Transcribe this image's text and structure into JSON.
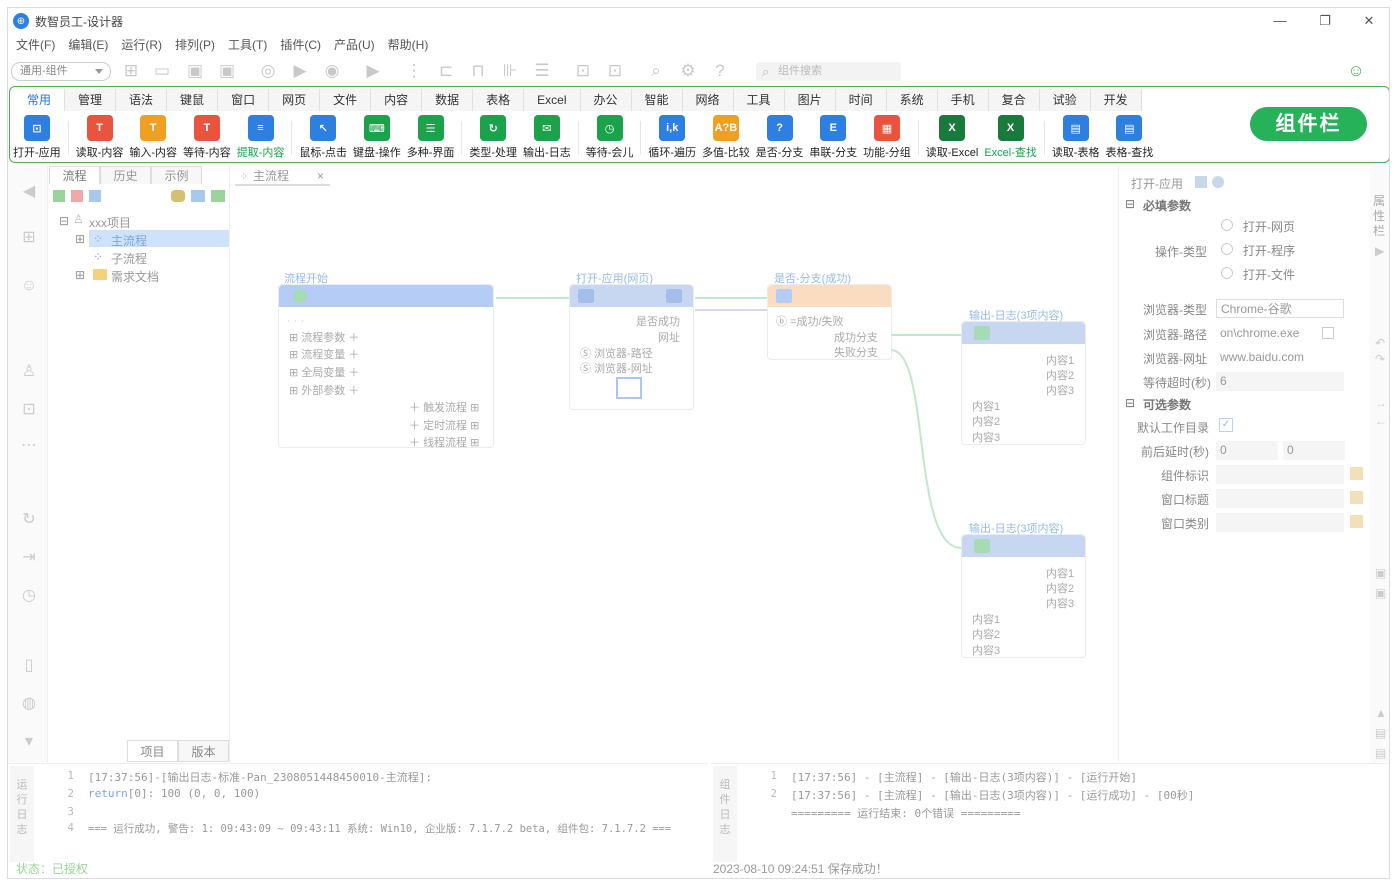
{
  "window": {
    "title": "数智员工-设计器",
    "minimize": "—",
    "maximize": "❐",
    "close": "✕"
  },
  "menu": [
    "文件(F)",
    "编辑(E)",
    "运行(R)",
    "排列(P)",
    "工具(T)",
    "插件(C)",
    "产品(U)",
    "帮助(H)"
  ],
  "toolbar": {
    "combo": "通用-组件",
    "search_placeholder": "组件搜索"
  },
  "component_tabs": [
    "常用",
    "管理",
    "语法",
    "键鼠",
    "窗口",
    "网页",
    "文件",
    "内容",
    "数据",
    "表格",
    "Excel",
    "办公",
    "智能",
    "网络",
    "工具",
    "图片",
    "时间",
    "系统",
    "手机",
    "复合",
    "试验",
    "开发"
  ],
  "components": [
    {
      "label": "打开-应用",
      "icon": "open-app-icon",
      "color": "#2d7fe0",
      "glyph": "⊡"
    },
    {
      "label": "读取-内容",
      "icon": "read-content-icon",
      "color": "#e8543d",
      "glyph": "T"
    },
    {
      "label": "输入-内容",
      "icon": "input-content-icon",
      "color": "#f0a020",
      "glyph": "T"
    },
    {
      "label": "等待-内容",
      "icon": "wait-content-icon",
      "color": "#e8543d",
      "glyph": "T"
    },
    {
      "label": "提取-内容",
      "icon": "extract-content-icon",
      "color": "#2d7fe0",
      "glyph": "≡",
      "green": true
    },
    {
      "label": "鼠标-点击",
      "icon": "mouse-click-icon",
      "color": "#2d7fe0",
      "glyph": "↖"
    },
    {
      "label": "键盘-操作",
      "icon": "keyboard-icon",
      "color": "#1aa34a",
      "glyph": "⌨"
    },
    {
      "label": "多种-界面",
      "icon": "multi-ui-icon",
      "color": "#1aa34a",
      "glyph": "☰"
    },
    {
      "label": "类型-处理",
      "icon": "type-process-icon",
      "color": "#1aa34a",
      "glyph": "↻"
    },
    {
      "label": "输出-日志",
      "icon": "output-log-icon",
      "color": "#1aa34a",
      "glyph": "✉"
    },
    {
      "label": "等待-会儿",
      "icon": "wait-icon",
      "color": "#1aa34a",
      "glyph": "◷"
    },
    {
      "label": "循环-遍历",
      "icon": "loop-icon",
      "color": "#2d7fe0",
      "glyph": "i,k"
    },
    {
      "label": "多值-比较",
      "icon": "compare-icon",
      "color": "#f0a020",
      "glyph": "A?B"
    },
    {
      "label": "是否-分支",
      "icon": "if-branch-icon",
      "color": "#2d7fe0",
      "glyph": "?"
    },
    {
      "label": "串联-分支",
      "icon": "serial-branch-icon",
      "color": "#2d7fe0",
      "glyph": "E"
    },
    {
      "label": "功能-分组",
      "icon": "function-group-icon",
      "color": "#e8543d",
      "glyph": "▦"
    },
    {
      "label": "读取-Excel",
      "icon": "read-excel-icon",
      "color": "#1a7a3c",
      "glyph": "X"
    },
    {
      "label": "Excel-查找",
      "icon": "excel-find-icon",
      "color": "#1a7a3c",
      "glyph": "X",
      "green": true
    },
    {
      "label": "读取-表格",
      "icon": "read-table-icon",
      "color": "#2d7fe0",
      "glyph": "▤"
    },
    {
      "label": "表格-查找",
      "icon": "table-find-icon",
      "color": "#2d7fe0",
      "glyph": "▤"
    }
  ],
  "badge": "组件栏",
  "left_panel": {
    "tabs": [
      "流程",
      "历史",
      "示例"
    ],
    "tree": {
      "root": "xxx项目",
      "children": [
        "主流程",
        "子流程",
        "需求文档"
      ]
    },
    "bottom_tabs": [
      "项目",
      "版本"
    ]
  },
  "canvas": {
    "tab": "主流程",
    "close": "×",
    "nodes": {
      "start": {
        "title": "流程开始",
        "rows": [
          "流程参数",
          "流程变量",
          "全局变量",
          "外部参数"
        ],
        "right_rows": [
          "触发流程",
          "定时流程",
          "线程流程"
        ],
        "dots": "· · ·"
      },
      "open": {
        "title": "打开-应用(网页)",
        "out": [
          "是否成功",
          "网址"
        ],
        "in": [
          "浏览器-路径",
          "浏览器-网址"
        ]
      },
      "branch": {
        "title": "是否-分支(成功)",
        "cond": "=成功/失败",
        "out": [
          "成功分支",
          "失败分支"
        ]
      },
      "log1": {
        "title": "输出-日志(3项内容)",
        "out": [
          "内容1",
          "内容2",
          "内容3"
        ],
        "in": [
          "内容1",
          "内容2",
          "内容3"
        ]
      },
      "log2": {
        "title": "输出-日志(3项内容)",
        "out": [
          "内容1",
          "内容2",
          "内容3"
        ],
        "in": [
          "内容1",
          "内容2",
          "内容3"
        ]
      }
    }
  },
  "props": {
    "header": "打开-应用",
    "required_title": "必填参数",
    "op_label": "操作-类型",
    "op_options": [
      "打开-网页",
      "打开-程序",
      "打开-文件"
    ],
    "browser_type_label": "浏览器-类型",
    "browser_type": "Chrome-谷歌",
    "browser_path_label": "浏览器-路径",
    "browser_path": "on\\chrome.exe",
    "browser_url_label": "浏览器-网址",
    "browser_url": "www.baidu.com",
    "timeout_label": "等待超时(秒)",
    "timeout": "6",
    "optional_title": "可选参数",
    "workdir_label": "默认工作目录",
    "delay_label": "前后延时(秒)",
    "delay_before": "0",
    "delay_after": "0",
    "comp_id_label": "组件标识",
    "win_title_label": "窗口标题",
    "win_class_label": "窗口类别",
    "side_label": "属性栏"
  },
  "log_left": {
    "label": "运行日志",
    "lines": [
      {
        "n": "1",
        "text": "[17:37:56]-[输出日志-标准-Pan_2308051448450010-主流程]:"
      },
      {
        "n": "2",
        "kw": "return",
        "text": "[0]: 100 (0, 0, 100)"
      },
      {
        "n": "3",
        "text": ""
      },
      {
        "n": "4",
        "text": "=== 运行成功, 警告: 1: 09:43:09 ~ 09:43:11  系统: Win10, 企业版: 7.1.7.2 beta, 组件包: 7.1.7.2 ==="
      }
    ]
  },
  "log_right": {
    "label": "组件日志",
    "lines": [
      {
        "n": "1",
        "text": "[17:37:56] - [主流程] - [输出-日志(3项内容)] - [运行开始]"
      },
      {
        "n": "2",
        "text": "[17:37:56] - [主流程] - [输出-日志(3项内容)] - [运行成功] - [00秒]"
      },
      {
        "n": "",
        "text": "========= 运行结束: 0个错误 ========="
      }
    ]
  },
  "status": {
    "left": "状态：已授权",
    "center": "2023-08-10 09:24:51 保存成功！"
  }
}
